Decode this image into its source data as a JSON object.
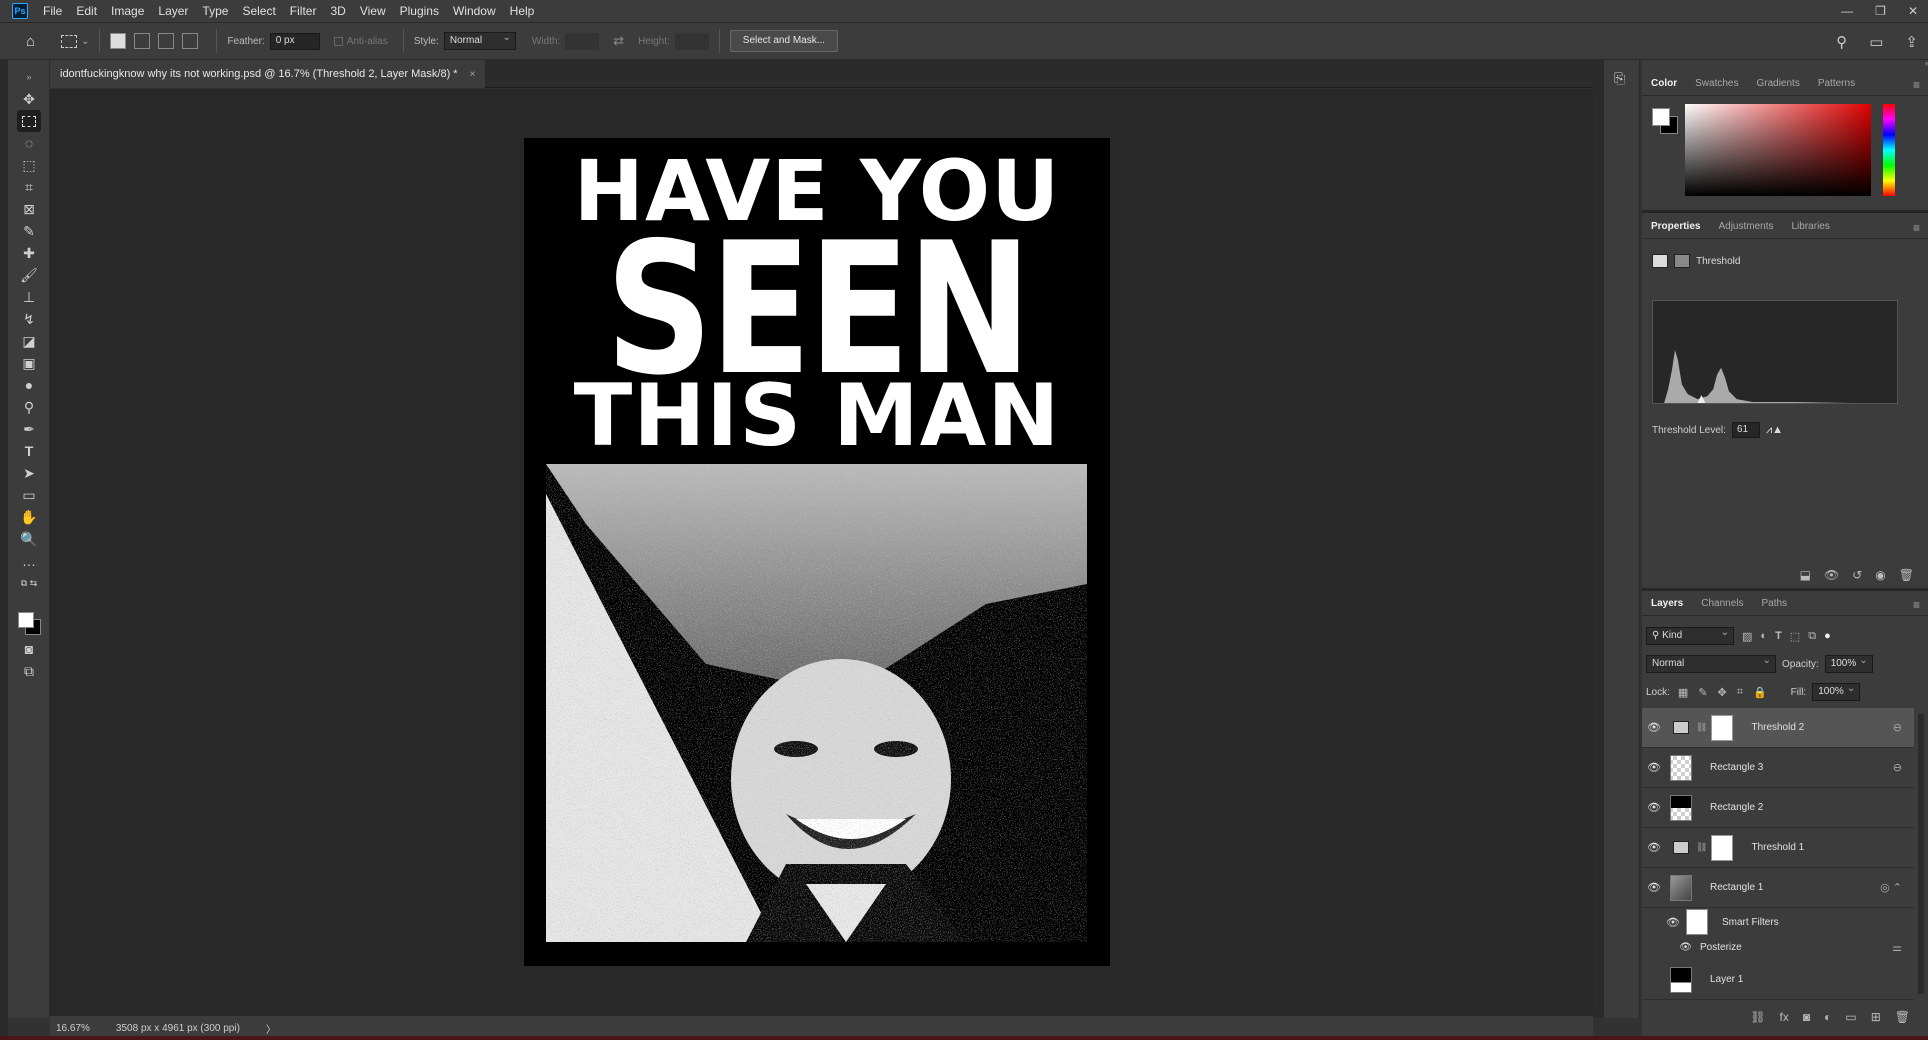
{
  "app": {
    "logo": "Ps"
  },
  "menu": [
    "File",
    "Edit",
    "Image",
    "Layer",
    "Type",
    "Select",
    "Filter",
    "3D",
    "View",
    "Plugins",
    "Window",
    "Help"
  ],
  "options": {
    "feather_label": "Feather:",
    "feather_value": "0 px",
    "anti_alias_label": "Anti-alias",
    "style_label": "Style:",
    "style_value": "Normal",
    "width_label": "Width:",
    "height_label": "Height:",
    "select_mask_label": "Select and Mask..."
  },
  "document": {
    "tab_title": "idontfuckingknow why its not working.psd @ 16.7% (Threshold 2, Layer Mask/8) *",
    "close": "×"
  },
  "poster": {
    "line1": "HAVE YOU",
    "line2": "SEEN",
    "line3": "THIS MAN"
  },
  "color_panel": {
    "tabs": [
      "Color",
      "Swatches",
      "Gradients",
      "Patterns"
    ],
    "fg": "#ffffff",
    "bg": "#000000"
  },
  "properties_panel": {
    "tabs": [
      "Properties",
      "Adjustments",
      "Libraries"
    ],
    "title": "Threshold",
    "threshold_label": "Threshold Level:",
    "threshold_value": "61"
  },
  "layers_panel": {
    "tabs": [
      "Layers",
      "Channels",
      "Paths"
    ],
    "kind_label": "Kind",
    "blend_mode": "Normal",
    "opacity_label": "Opacity:",
    "opacity_value": "100%",
    "lock_label": "Lock:",
    "fill_label": "Fill:",
    "fill_value": "100%",
    "layers": [
      {
        "name": "Threshold 2"
      },
      {
        "name": "Rectangle 3"
      },
      {
        "name": "Rectangle 2"
      },
      {
        "name": "Threshold 1"
      },
      {
        "name": "Rectangle 1"
      },
      {
        "name": "Smart Filters"
      },
      {
        "name": "Posterize"
      },
      {
        "name": "Layer 1"
      }
    ]
  },
  "status": {
    "zoom": "16.67%",
    "doc_size": "3508 px x 4961 px (300 ppi)",
    "arrow": "〉"
  }
}
